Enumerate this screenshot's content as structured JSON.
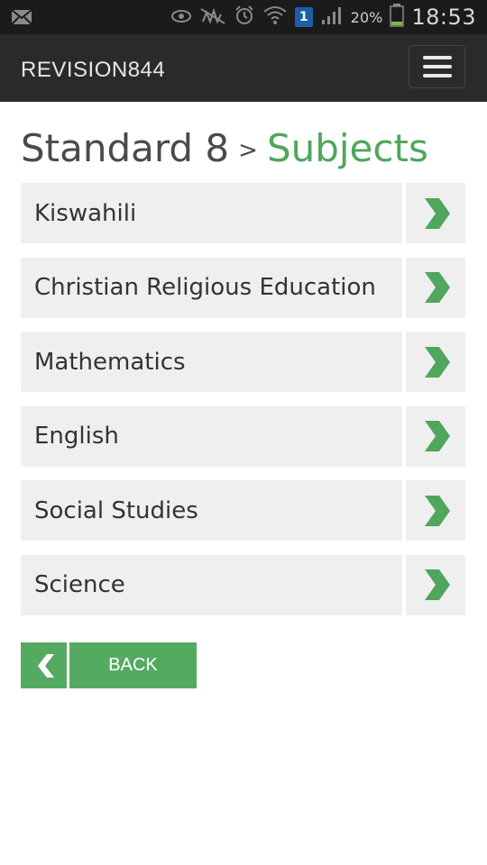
{
  "status_bar": {
    "icons": [
      "notification-icon",
      "eye-icon",
      "mute-icon",
      "alarm-icon",
      "wifi-icon",
      "sim-icon",
      "signal-icon",
      "battery-icon"
    ],
    "sim_badge": "1",
    "battery_percent": "20%",
    "time": "18:53"
  },
  "navbar": {
    "brand": "REVISION844",
    "menu_icon": "hamburger-menu-icon"
  },
  "page": {
    "title": "Standard 8",
    "separator": ">",
    "subtitle": "Subjects"
  },
  "subjects": [
    {
      "label": "Kiswahili"
    },
    {
      "label": "Christian Religious Education"
    },
    {
      "label": "Mathematics"
    },
    {
      "label": "English"
    },
    {
      "label": "Social Studies"
    },
    {
      "label": "Science"
    }
  ],
  "back": {
    "label": "BACK",
    "icon": "chevron-left-icon"
  },
  "colors": {
    "accent": "#4fa65c",
    "navbar": "#2a2a2a",
    "statusbar": "#1b1b1b",
    "row_bg": "#efefef"
  }
}
